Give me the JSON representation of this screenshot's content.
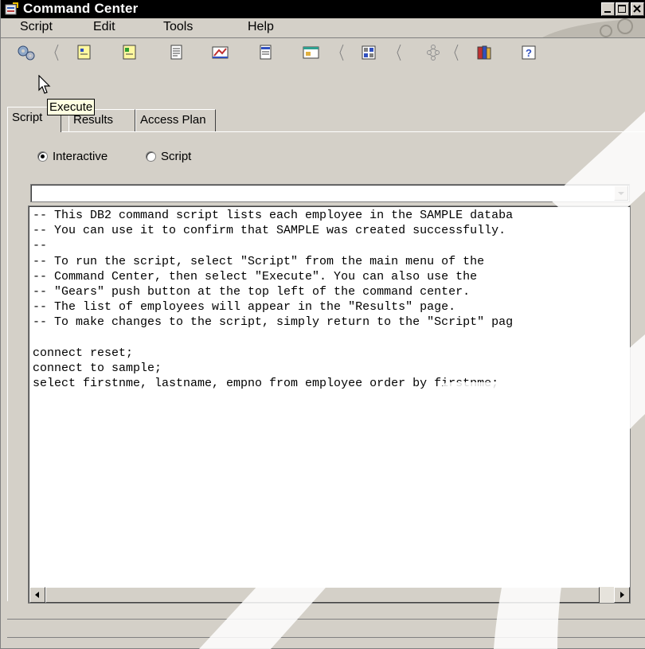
{
  "window": {
    "title": "Command Center",
    "icon": "command-center-icon",
    "controls": [
      "minimize-icon",
      "maximize-icon",
      "close-icon"
    ]
  },
  "menu": {
    "items": [
      "Script",
      "Edit",
      "Tools",
      "Help"
    ]
  },
  "toolbar": {
    "buttons": [
      "execute-gears-icon",
      "script-icon",
      "query-icon",
      "document-icon",
      "results-icon",
      "list-icon",
      "panel-icon",
      "grid-icon",
      "tree-icon",
      "book-icon",
      "help-icon"
    ],
    "tooltip": "Execute"
  },
  "tabs": [
    {
      "label": "Script",
      "active": true
    },
    {
      "label": "Results",
      "active": false
    },
    {
      "label": "Access Plan",
      "active": false
    }
  ],
  "mode": {
    "options": [
      "Interactive",
      "Script"
    ],
    "selected": "Interactive"
  },
  "command_history": {
    "value": ""
  },
  "editor": {
    "lines": [
      "-- This DB2 command script lists each employee in the SAMPLE databa",
      "-- You can use it to confirm that SAMPLE was created successfully.",
      "--",
      "-- To run the script, select \"Script\" from the main menu of the",
      "-- Command Center, then select \"Execute\". You can also use the",
      "-- \"Gears\" push button at the top left of the command center.",
      "-- The list of employees will appear in the \"Results\" page.",
      "-- To make changes to the script, simply return to the \"Script\" pag",
      "",
      "connect reset;",
      "connect to sample;",
      "select firstnme, lastname, empno from employee order by firstnme;"
    ]
  },
  "colors": {
    "titlebar": "#000000",
    "face": "#d4d0c8",
    "tooltip": "#ffffe1"
  }
}
